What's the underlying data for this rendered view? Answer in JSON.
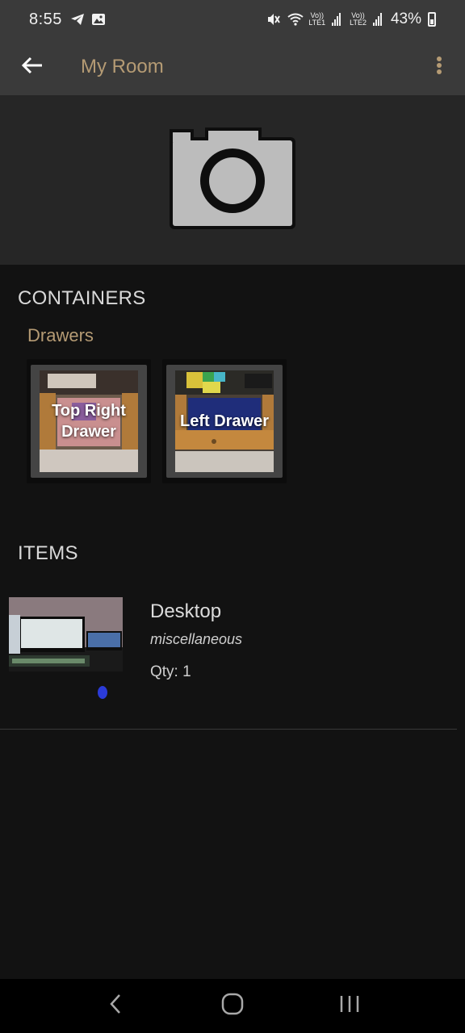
{
  "status_bar": {
    "time": "8:55",
    "battery": "43%",
    "sim1": "LTE1",
    "sim2": "LTE2",
    "icons": [
      "telegram-icon",
      "gallery-icon",
      "mute-icon",
      "wifi-icon",
      "signal-icon",
      "battery-icon"
    ]
  },
  "app_bar": {
    "title": "My Room",
    "back_icon": "arrow-back-icon",
    "menu_icon": "more-vert-icon"
  },
  "header": {
    "image_icon": "camera-icon"
  },
  "containers": {
    "heading": "CONTAINERS",
    "group": "Drawers",
    "cards": [
      {
        "label": "Top Right Drawer"
      },
      {
        "label": "Left Drawer"
      }
    ]
  },
  "items": {
    "heading": "ITEMS",
    "list": [
      {
        "name": "Desktop",
        "category": "miscellaneous",
        "qty": "Qty: 1"
      }
    ]
  },
  "nav_bar": {
    "icons": [
      "back-nav-icon",
      "home-nav-icon",
      "recents-nav-icon"
    ]
  },
  "colors": {
    "accent": "#b59b74",
    "background": "#121212",
    "app_bar": "#3a3a3a"
  }
}
